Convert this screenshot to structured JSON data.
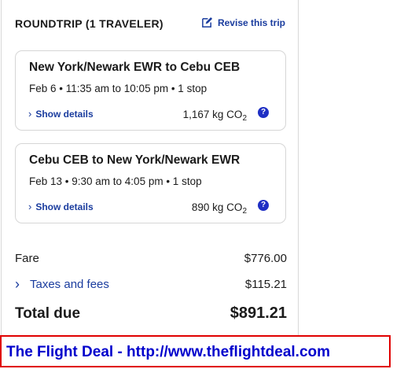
{
  "header": {
    "title": "ROUNDTRIP (1 TRAVELER)",
    "revise_label": "Revise this trip",
    "revise_icon": "edit-icon"
  },
  "flights": [
    {
      "route": "New York/Newark EWR to Cebu CEB",
      "times": "Feb 6 • 11:35 am to 10:05 pm • 1 stop",
      "details_label": "Show details",
      "co2_value": "1,167 kg CO",
      "co2_sub": "2",
      "help": "?"
    },
    {
      "route": "Cebu CEB to New York/Newark EWR",
      "times": "Feb 13 • 9:30 am to 4:05 pm • 1 stop",
      "details_label": "Show details",
      "co2_value": "890 kg CO",
      "co2_sub": "2",
      "help": "?"
    }
  ],
  "pricing": {
    "fare_label": "Fare",
    "fare_value": "$776.00",
    "taxes_label": "Taxes and fees",
    "taxes_value": "$115.21",
    "total_label": "Total due",
    "total_value": "$891.21"
  },
  "banner": {
    "text": "The Flight Deal - http://www.theflightdeal.com"
  },
  "colors": {
    "link": "#1a3c9e",
    "help_badge": "#1f2fc4",
    "banner_border": "#e00000",
    "banner_text": "#0000cc"
  }
}
